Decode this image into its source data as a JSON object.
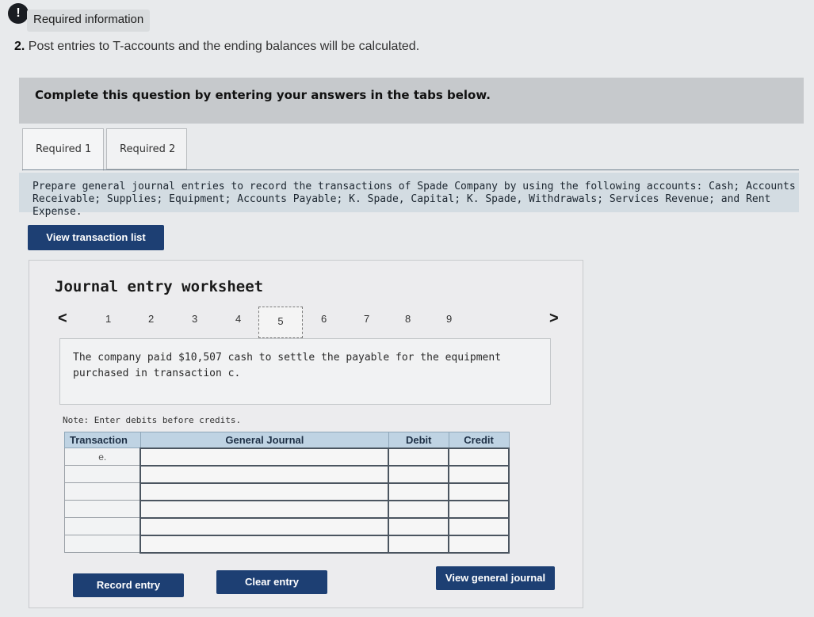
{
  "header": {
    "alert_symbol": "!",
    "required_info": "Required information",
    "question_number": "2.",
    "question_text": "Post entries to T-accounts and the ending balances will be calculated."
  },
  "banner": "Complete this question by entering your answers in the tabs below.",
  "tabs": [
    {
      "label": "Required 1",
      "active": true
    },
    {
      "label": "Required 2",
      "active": false
    }
  ],
  "instructions": "Prepare general journal entries to record the transactions of Spade Company by using the following accounts: Cash; Accounts Receivable; Supplies; Equipment; Accounts Payable; K. Spade, Capital; K. Spade, Withdrawals; Services Revenue; and Rent Expense.",
  "buttons": {
    "view_transaction_list": "View transaction list",
    "record_entry": "Record entry",
    "clear_entry": "Clear entry",
    "view_general_journal": "View general journal"
  },
  "worksheet": {
    "title": "Journal entry worksheet",
    "prev_arrow": "<",
    "next_arrow": ">",
    "pages": [
      "1",
      "2",
      "3",
      "4",
      "5",
      "6",
      "7",
      "8",
      "9"
    ],
    "active_page": "5",
    "description": "The company paid $10,507 cash to settle the payable for the equipment purchased in transaction c.",
    "note": "Note: Enter debits before credits."
  },
  "journal": {
    "headers": [
      "Transaction",
      "General Journal",
      "Debit",
      "Credit"
    ],
    "rows": [
      {
        "transaction": "e."
      },
      {
        "transaction": ""
      },
      {
        "transaction": ""
      },
      {
        "transaction": ""
      },
      {
        "transaction": ""
      },
      {
        "transaction": ""
      }
    ]
  },
  "colors": {
    "button_bg": "#1d3f73",
    "table_header_bg": "#bfd3e3",
    "banner_bg": "#c6c9cc"
  }
}
